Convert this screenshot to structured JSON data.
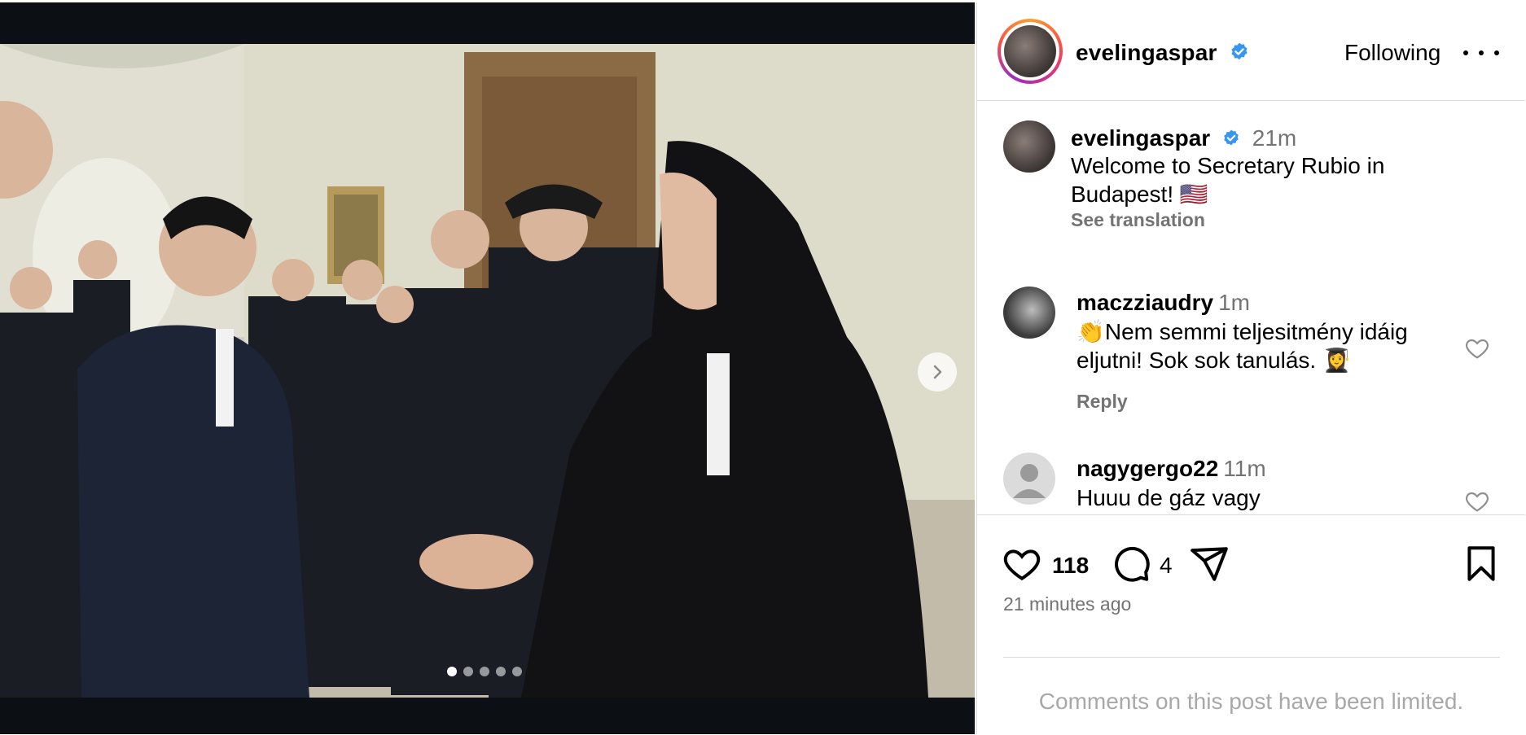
{
  "post": {
    "username": "evelingaspar",
    "follow_label": "Following",
    "caption_time": "21m",
    "caption_line1": "Welcome to Secretary Rubio in",
    "caption_line2": "Budapest! 🇺🇸",
    "see_translation": "See translation",
    "likes": "118",
    "comments_count": "4",
    "posted_ago": "21 minutes ago",
    "comments_limited": "Comments on this post have been limited."
  },
  "comments": [
    {
      "username": "maczziaudry",
      "time": "1m",
      "line1": "👏Nem semmi teljesitmény idáig",
      "line2": "eljutni! Sok sok tanulás. 👩‍🎓",
      "reply": "Reply"
    },
    {
      "username": "nagygergo22",
      "time": "11m",
      "line1": "Huuu de gáz vagy"
    }
  ],
  "carousel": {
    "count": 5,
    "active_index": 0
  },
  "colors": {
    "verified": "#3797f0",
    "muted": "#737373",
    "divider": "#dbdbdb"
  },
  "icons": [
    "chevron-right-icon",
    "verified-badge-icon",
    "more-icon",
    "heart-icon",
    "comment-icon",
    "share-icon",
    "bookmark-icon"
  ]
}
